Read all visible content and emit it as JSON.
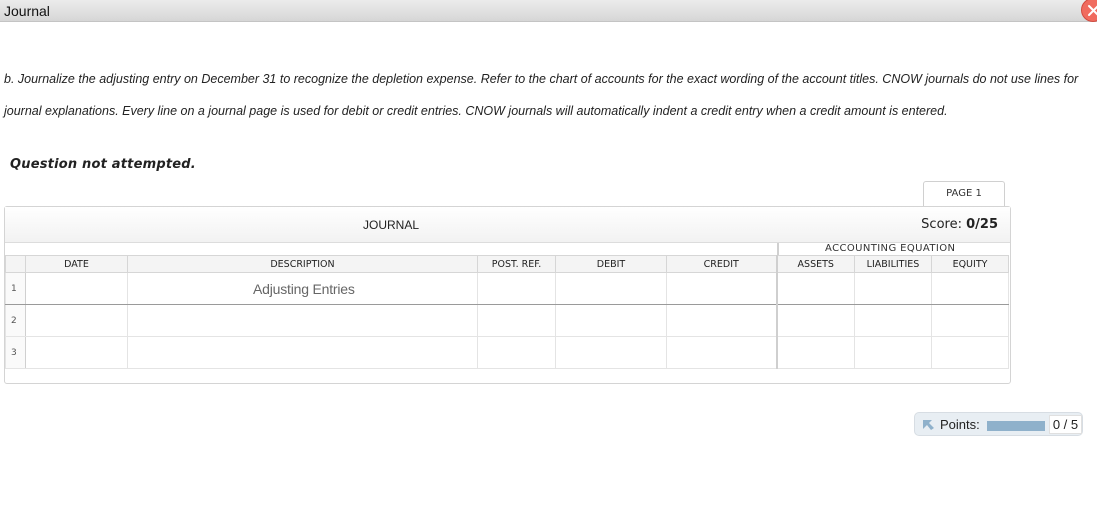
{
  "window": {
    "title": "Journal"
  },
  "instructions": "b. Journalize the adjusting entry on December 31 to recognize the depletion expense. Refer to the chart of accounts for the exact wording of the account titles. CNOW journals do not use lines for journal explanations. Every line on a journal page is used for debit or credit entries. CNOW journals will automatically indent a credit entry when a credit amount is entered.",
  "status": "Question not attempted.",
  "page_tab": "PAGE 1",
  "journal": {
    "title": "JOURNAL",
    "score_label": "Score: ",
    "score_value": "0/25",
    "equation_label": "ACCOUNTING EQUATION",
    "columns": {
      "date": "DATE",
      "description": "DESCRIPTION",
      "post_ref": "POST. REF.",
      "debit": "DEBIT",
      "credit": "CREDIT",
      "assets": "ASSETS",
      "liabilities": "LIABILITIES",
      "equity": "EQUITY"
    },
    "rows": [
      {
        "num": "1",
        "description": "Adjusting Entries"
      },
      {
        "num": "2",
        "description": ""
      },
      {
        "num": "3",
        "description": ""
      }
    ]
  },
  "points": {
    "label": "Points:",
    "value": "0 / 5",
    "fraction": 0
  },
  "colors": {
    "close": "#f06b5f",
    "points_bar": "#8fb1cb",
    "points_bg": "#e8eef3"
  }
}
